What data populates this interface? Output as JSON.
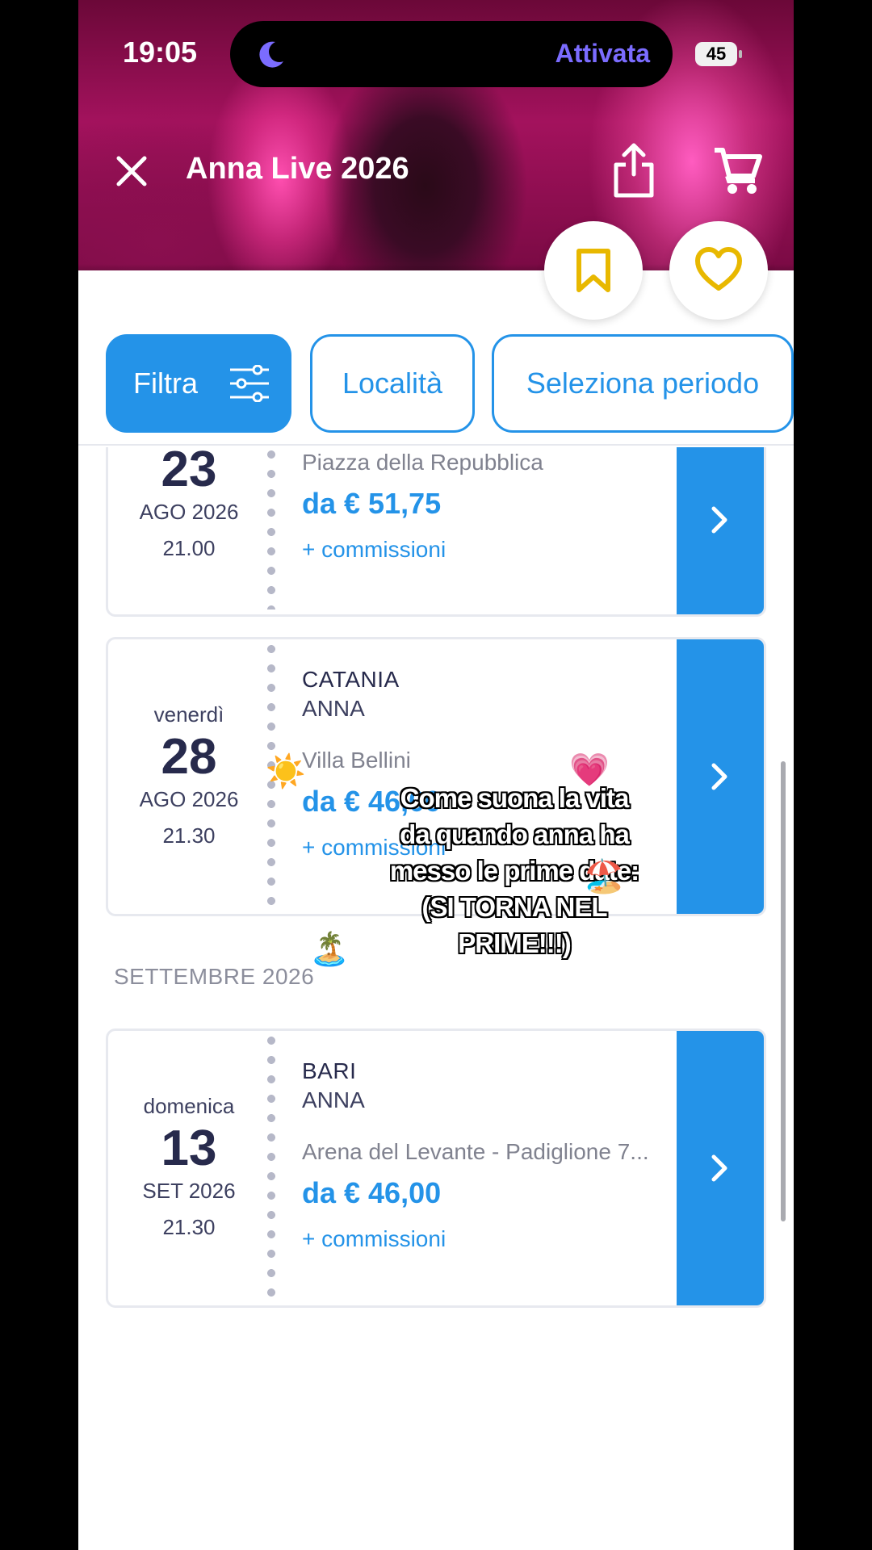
{
  "status_bar": {
    "time": "19:05",
    "focus_label": "Attivata",
    "battery": "45"
  },
  "header": {
    "title": "Anna Live 2026"
  },
  "filters": {
    "filter_label": "Filtra",
    "location_label": "Località",
    "period_label": "Seleziona periodo"
  },
  "events": [
    {
      "weekday": "",
      "day": "23",
      "month": "AGO 2026",
      "time": "21.00",
      "city": "",
      "artist": "",
      "venue": "Piazza della Repubblica",
      "price": "da € 51,75",
      "fees": "+ commissioni"
    },
    {
      "weekday": "venerdì",
      "day": "28",
      "month": "AGO 2026",
      "time": "21.30",
      "city": "CATANIA",
      "artist": "ANNA",
      "venue": "Villa Bellini",
      "price": "da € 46,00",
      "fees": "+ commissioni"
    },
    {
      "weekday": "domenica",
      "day": "13",
      "month": "SET 2026",
      "time": "21.30",
      "city": "BARI",
      "artist": "ANNA",
      "venue": "Arena del Levante - Padiglione 7...",
      "price": "da € 46,00",
      "fees": "+ commissioni"
    }
  ],
  "section": {
    "september": "SETTEMBRE 2026"
  },
  "overlay": {
    "line1": "Come suona la vita",
    "line2": "da quando anna ha",
    "line3": "messo le prime date:",
    "line4": "(SI TORNA NEL",
    "line5": "PRIME!!!)",
    "emoji_sun": "☀️",
    "emoji_heart": "💗",
    "emoji_beach": "🏖️",
    "emoji_island": "🏝️"
  },
  "colors": {
    "accent": "#2493e8",
    "bookmark_gold": "#e8b800",
    "focus_purple": "#7b6cff"
  },
  "icons": [
    "moon-icon",
    "close-icon",
    "share-icon",
    "cart-icon",
    "bookmark-icon",
    "heart-icon",
    "sliders-icon",
    "chevron-right-icon"
  ]
}
